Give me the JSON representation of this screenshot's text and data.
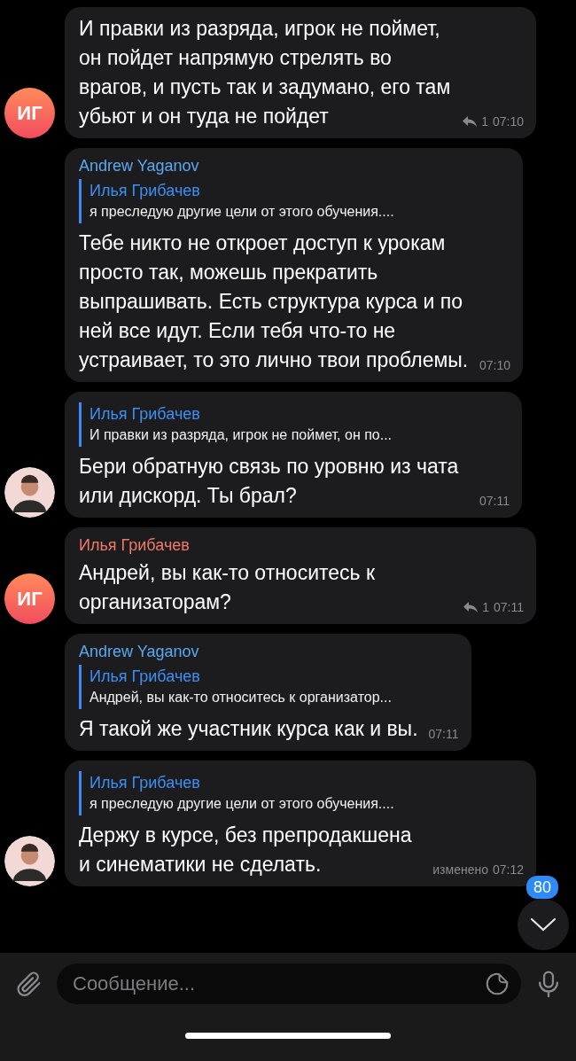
{
  "messages": [
    {
      "avatar": {
        "kind": "initials",
        "text": "ИГ"
      },
      "text": "И правки из разряда, игрок не поймет, он пойдет напрямую стрелять во врагов, и пусть так и задумано, его там убьют и он туда не пойдет",
      "replies": "1",
      "time": "07:10"
    },
    {
      "sender": {
        "name": "Andrew Yaganov",
        "color": "#5aa9f0"
      },
      "reply_to": {
        "author": "Илья Грибачев",
        "text": "я преследую другие цели от этого обучения...."
      },
      "text": "Тебе никто не откроет доступ к урокам просто так, можешь прекратить выпрашивать. Есть структура курса и по ней все идут. Если тебя что-то не устраивает, то это лично твои проблемы.",
      "time": "07:10"
    },
    {
      "avatar": {
        "kind": "photo"
      },
      "reply_to": {
        "author": "Илья Грибачев",
        "text": "И правки из разряда, игрок не поймет, он по..."
      },
      "text": "Бери обратную связь по уровню из чата или дискорд. Ты брал?",
      "time": "07:11"
    },
    {
      "avatar": {
        "kind": "initials",
        "text": "ИГ"
      },
      "sender": {
        "name": "Илья Грибачев",
        "color": "#f2796a"
      },
      "text": "Андрей, вы как-то относитесь к организаторам?",
      "replies": "1",
      "time": "07:11"
    },
    {
      "sender": {
        "name": "Andrew Yaganov",
        "color": "#5aa9f0"
      },
      "reply_to": {
        "author": "Илья Грибачев",
        "text": "Андрей, вы как-то относитесь к организатор..."
      },
      "text": "Я такой же участник курса как и вы.",
      "time": "07:11"
    },
    {
      "avatar": {
        "kind": "photo"
      },
      "reply_to": {
        "author": "Илья Грибачев",
        "text": "я преследую другие цели от этого обучения...."
      },
      "text": "Держу в курсе, без препродакшена и синематики не сделать.",
      "edited": "изменено",
      "time": "07:12"
    }
  ],
  "scroll_down": {
    "badge": "80"
  },
  "composer": {
    "placeholder": "Сообщение..."
  }
}
